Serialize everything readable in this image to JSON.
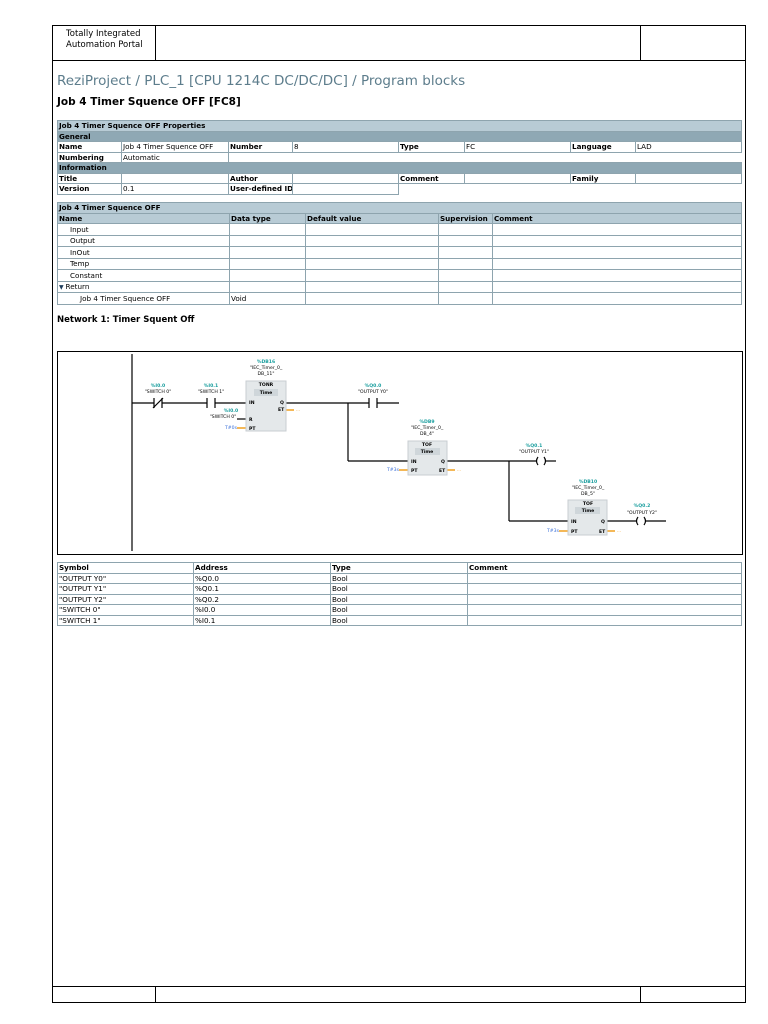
{
  "header": {
    "portal_line1": "Totally Integrated",
    "portal_line2": "Automation Portal"
  },
  "page_title": "ReziProject / PLC_1 [CPU 1214C DC/DC/DC] / Program blocks",
  "block_title": "Job 4 Timer Squence OFF [FC8]",
  "properties": {
    "title": "Job 4 Timer Squence OFF Properties",
    "general": "General",
    "name_label": "Name",
    "name_value": "Job 4 Timer Squence OFF",
    "number_label": "Number",
    "number_value": "8",
    "type_label": "Type",
    "type_value": "FC",
    "language_label": "Language",
    "language_value": "LAD",
    "numbering_label": "Numbering",
    "numbering_value": "Automatic",
    "information": "Information",
    "title_label": "Title",
    "title_value": "",
    "author_label": "Author",
    "author_value": "",
    "comment_label": "Comment",
    "comment_value": "",
    "family_label": "Family",
    "family_value": "",
    "version_label": "Version",
    "version_value": "0.1",
    "userid_label": "User-defined ID",
    "userid_value": ""
  },
  "interface": {
    "title": "Job 4 Timer Squence OFF",
    "columns": [
      "Name",
      "Data type",
      "Default value",
      "Supervision",
      "Comment"
    ],
    "rows": [
      {
        "name": "Input",
        "type": "",
        "indent": 1
      },
      {
        "name": "Output",
        "type": "",
        "indent": 1
      },
      {
        "name": "InOut",
        "type": "",
        "indent": 1
      },
      {
        "name": "Temp",
        "type": "",
        "indent": 1
      },
      {
        "name": "Constant",
        "type": "",
        "indent": 1
      },
      {
        "name": "Return",
        "type": "",
        "indent": 0,
        "expanded": true
      },
      {
        "name": "Job 4 Timer Squence OFF",
        "type": "Void",
        "indent": 2
      }
    ]
  },
  "network": {
    "title": "Network 1: Timer Squent Off",
    "contact1": {
      "addr": "%I0.0",
      "sym": "\"SWITCH 0\""
    },
    "contact2": {
      "addr": "%I0.1",
      "sym": "\"SWITCH 1\""
    },
    "tonr": {
      "db": "%DB16",
      "inst1": "\"IEC_Timer_0_",
      "inst2": "DB_11\"",
      "type": "TONR",
      "time": "Time",
      "in": "IN",
      "q": "Q",
      "et": "ET",
      "r": "R",
      "pt": "PT",
      "r_addr": "%I0.0",
      "r_sym": "\"SWITCH 0\"",
      "pt_val": "T#0s",
      "et_val": "..."
    },
    "contact3": {
      "addr": "%Q0.0",
      "sym": "\"OUTPUT Y0\""
    },
    "tof1": {
      "db": "%DB9",
      "inst1": "\"IEC_Timer_0_",
      "inst2": "DB_4\"",
      "type": "TOF",
      "time": "Time",
      "in": "IN",
      "q": "Q",
      "et": "ET",
      "pt": "PT",
      "pt_val": "T#3s",
      "et_val": "..."
    },
    "coil1": {
      "addr": "%Q0.1",
      "sym": "\"OUTPUT Y1\""
    },
    "tof2": {
      "db": "%DB10",
      "inst1": "\"IEC_Timer_0_",
      "inst2": "DB_5\"",
      "type": "TOF",
      "time": "Time",
      "in": "IN",
      "q": "Q",
      "et": "ET",
      "pt": "PT",
      "pt_val": "T#3s",
      "et_val": "..."
    },
    "coil2": {
      "addr": "%Q0.2",
      "sym": "\"OUTPUT Y2\""
    }
  },
  "symbols": {
    "columns": [
      "Symbol",
      "Address",
      "Type",
      "Comment"
    ],
    "rows": [
      [
        "\"OUTPUT Y0\"",
        "%Q0.0",
        "Bool",
        ""
      ],
      [
        "\"OUTPUT Y1\"",
        "%Q0.1",
        "Bool",
        ""
      ],
      [
        "\"OUTPUT Y2\"",
        "%Q0.2",
        "Bool",
        ""
      ],
      [
        "\"SWITCH 0\"",
        "%I0.0",
        "Bool",
        ""
      ],
      [
        "\"SWITCH 1\"",
        "%I0.1",
        "Bool",
        ""
      ]
    ]
  },
  "colors": {
    "title": "#5d7d8c",
    "header": "#b8cbd5",
    "section": "#8fa8b4",
    "address": "#1a9e9e",
    "time_const": "#3a6fd8",
    "pin": "#f0a020"
  }
}
